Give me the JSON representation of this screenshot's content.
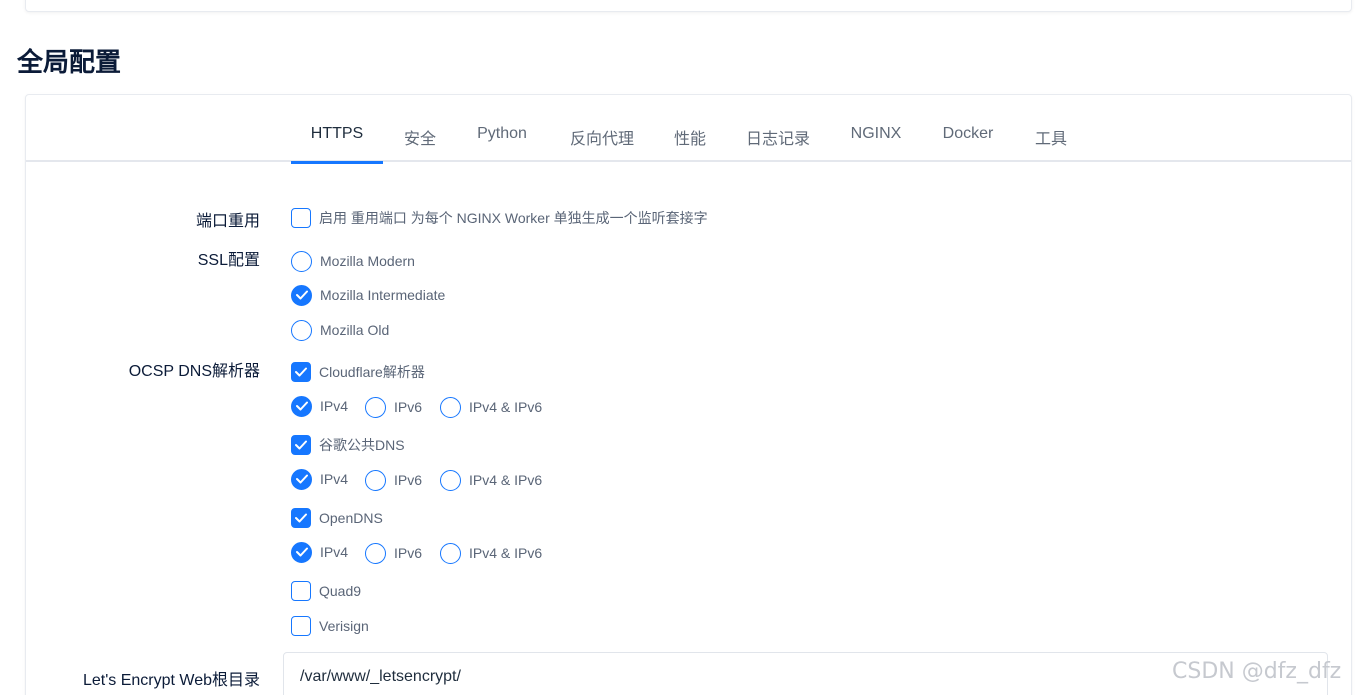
{
  "page_title": "全局配置",
  "tabs": [
    {
      "label": "HTTPS",
      "active": true
    },
    {
      "label": "安全",
      "active": false
    },
    {
      "label": "Python",
      "active": false
    },
    {
      "label": "反向代理",
      "active": false
    },
    {
      "label": "性能",
      "active": false
    },
    {
      "label": "日志记录",
      "active": false
    },
    {
      "label": "NGINX",
      "active": false
    },
    {
      "label": "Docker",
      "active": false
    },
    {
      "label": "工具",
      "active": false
    }
  ],
  "reuseport": {
    "label": "端口重用",
    "checkbox_label": "启用 重用端口 为每个 NGINX Worker 单独生成一个监听套接字",
    "checked": false
  },
  "ssl": {
    "label": "SSL配置",
    "options": [
      {
        "label": "Mozilla Modern",
        "checked": false
      },
      {
        "label": "Mozilla Intermediate",
        "checked": true
      },
      {
        "label": "Mozilla Old",
        "checked": false
      }
    ]
  },
  "ocsp": {
    "label": "OCSP DNS解析器",
    "resolvers": [
      {
        "label": "Cloudflare解析器",
        "checked": true,
        "ip_options": [
          {
            "label": "IPv4",
            "checked": true
          },
          {
            "label": "IPv6",
            "checked": false
          },
          {
            "label": "IPv4 & IPv6",
            "checked": false
          }
        ]
      },
      {
        "label": "谷歌公共DNS",
        "checked": true,
        "ip_options": [
          {
            "label": "IPv4",
            "checked": true
          },
          {
            "label": "IPv6",
            "checked": false
          },
          {
            "label": "IPv4 & IPv6",
            "checked": false
          }
        ]
      },
      {
        "label": "OpenDNS",
        "checked": true,
        "ip_options": [
          {
            "label": "IPv4",
            "checked": true
          },
          {
            "label": "IPv6",
            "checked": false
          },
          {
            "label": "IPv4 & IPv6",
            "checked": false
          }
        ]
      },
      {
        "label": "Quad9",
        "checked": false
      },
      {
        "label": "Verisign",
        "checked": false
      }
    ]
  },
  "letsencrypt": {
    "label": "Let's Encrypt Web根目录",
    "value": "/var/www/_letsencrypt/"
  },
  "watermark": "CSDN @dfz_dfz",
  "colors": {
    "accent": "#1677ff",
    "title": "#0b1b38",
    "muted": "#5a6577"
  }
}
